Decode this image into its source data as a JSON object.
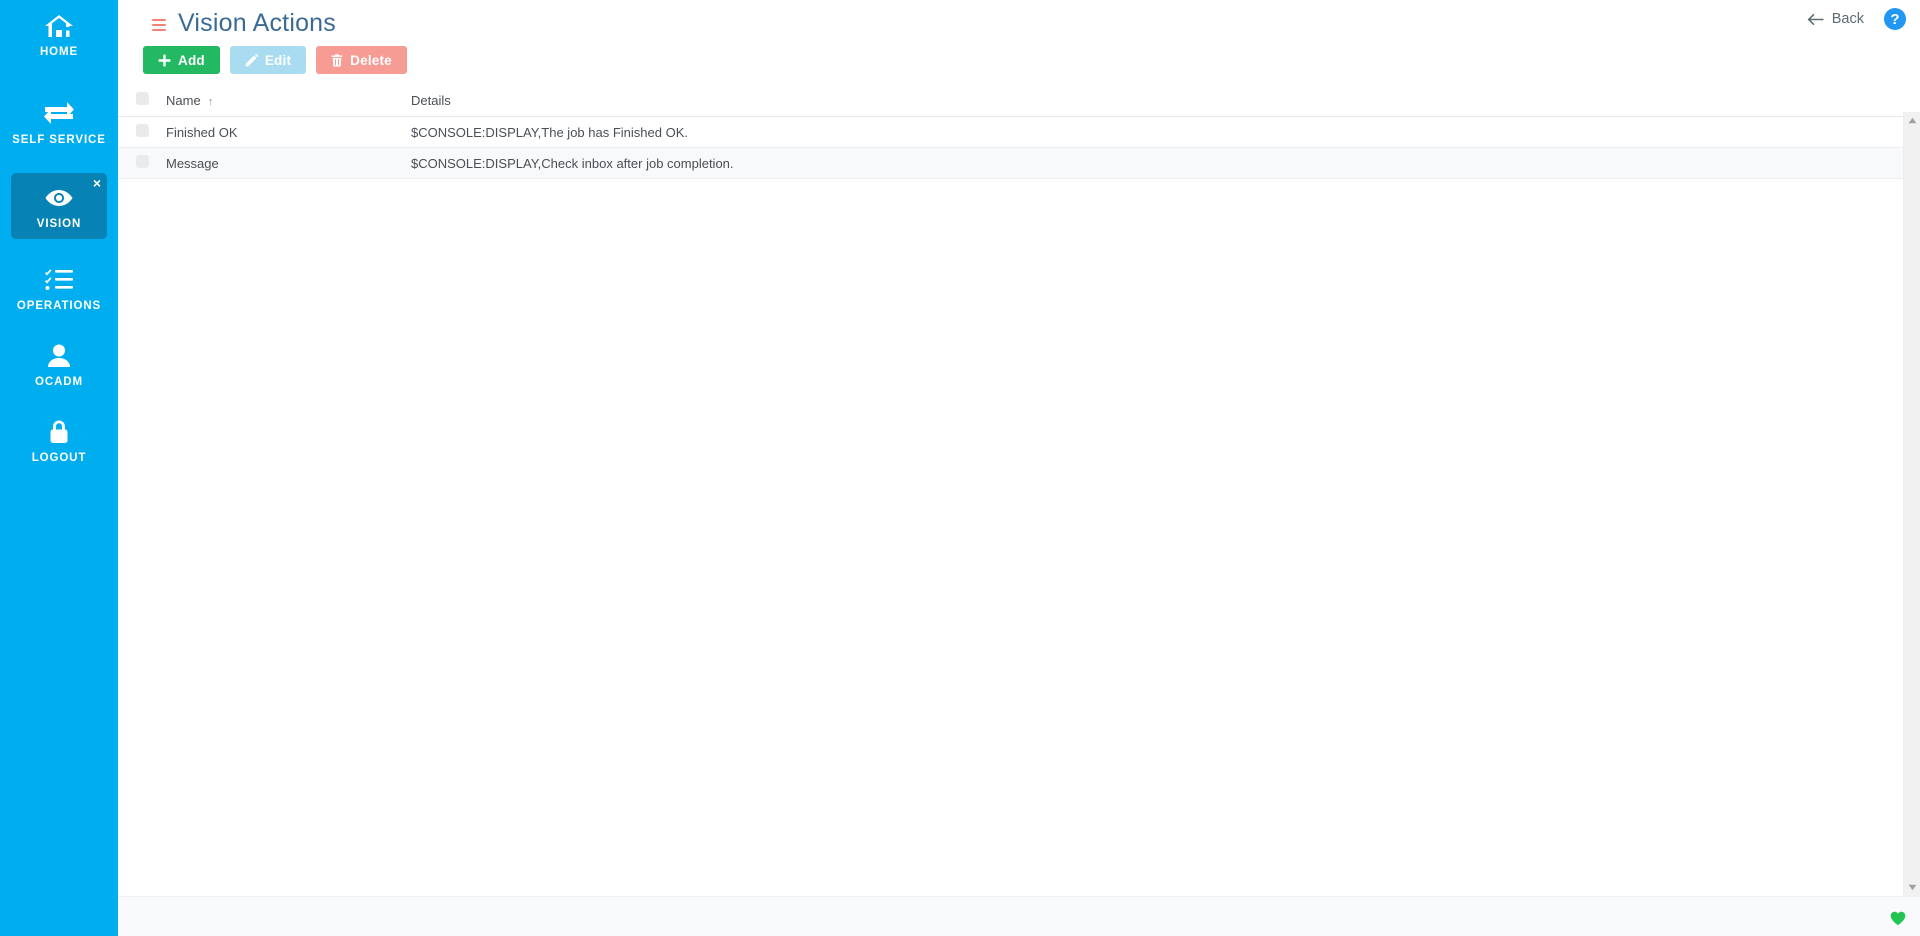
{
  "sidebar": {
    "items": [
      {
        "label": "HOME",
        "icon": "home-icon",
        "active": false,
        "closable": false
      },
      {
        "label": "SELF SERVICE",
        "icon": "transfer-icon",
        "active": false,
        "closable": false
      },
      {
        "label": "VISION",
        "icon": "eye-icon",
        "active": true,
        "closable": true,
        "close_label": "×"
      },
      {
        "label": "OPERATIONS",
        "icon": "checklist-icon",
        "active": false,
        "closable": false
      },
      {
        "label": "OCADM",
        "icon": "user-icon",
        "active": false,
        "closable": false
      },
      {
        "label": "LOGOUT",
        "icon": "lock-icon",
        "active": false,
        "closable": false
      }
    ],
    "bg_color": "#00AEEF",
    "active_bg_color": "#0683B4"
  },
  "header": {
    "menu_icon": "hamburger-icon",
    "title": "Vision Actions",
    "title_color": "#3A6B96",
    "back_label": "Back",
    "back_icon": "arrow-left-icon",
    "help_icon": "question-mark-icon",
    "help_label": "?"
  },
  "toolbar": {
    "add_label": "Add",
    "add_icon": "plus-icon",
    "add_color": "#22B962",
    "edit_label": "Edit",
    "edit_icon": "pencil-icon",
    "edit_color": "#A9DCF0",
    "edit_disabled": true,
    "delete_label": "Delete",
    "delete_icon": "trash-icon",
    "delete_color": "#F79C94"
  },
  "table": {
    "columns": [
      {
        "key": "check",
        "label": ""
      },
      {
        "key": "name",
        "label": "Name",
        "sort": "asc",
        "sort_glyph": "↑"
      },
      {
        "key": "details",
        "label": "Details"
      }
    ],
    "rows": [
      {
        "checked": false,
        "name": "Finished OK",
        "details": "$CONSOLE:DISPLAY,The job has Finished OK."
      },
      {
        "checked": false,
        "name": "Message",
        "details": "$CONSOLE:DISPLAY,Check inbox after job completion."
      }
    ]
  },
  "scrollbar": {
    "up_icon": "caret-up-icon",
    "down_icon": "caret-down-icon"
  },
  "footer": {
    "status_icon": "heart-icon",
    "status_color": "#23C552"
  }
}
